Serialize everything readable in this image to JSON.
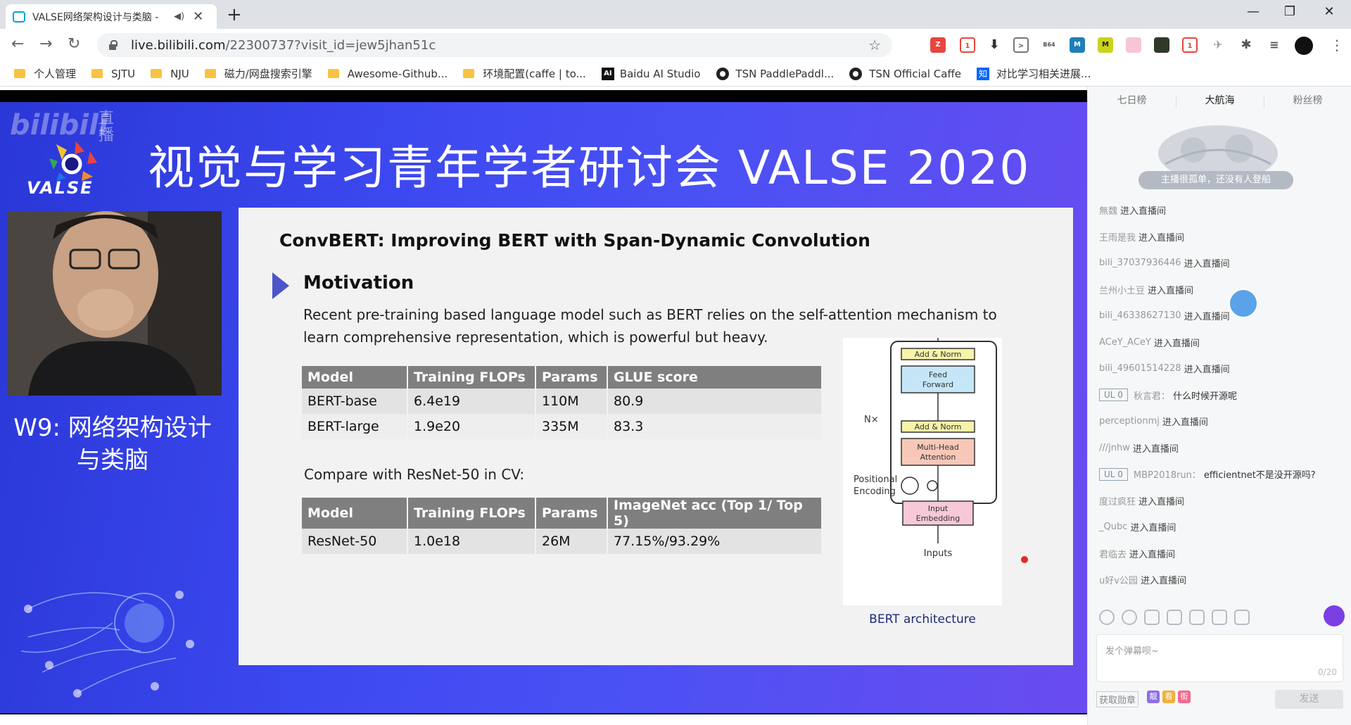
{
  "browser": {
    "tab_title": "VALSE网络架构设计与类脑 -",
    "tab_audio_icon": "speaker-icon",
    "url_host": "live.bilibili.com",
    "url_path": "/22300737?visit_id=jew5jhan51c",
    "bookmarks": [
      {
        "label": "个人管理",
        "icon": "folder"
      },
      {
        "label": "SJTU",
        "icon": "folder"
      },
      {
        "label": "NJU",
        "icon": "folder"
      },
      {
        "label": "磁力/网盘搜索引擎",
        "icon": "folder"
      },
      {
        "label": "Awesome-Github...",
        "icon": "folder"
      },
      {
        "label": "环境配置(caffe | to...",
        "icon": "folder"
      },
      {
        "label": "Baidu AI Studio",
        "icon": "ai"
      },
      {
        "label": "TSN PaddlePaddl...",
        "icon": "github"
      },
      {
        "label": "TSN Official Caffe",
        "icon": "github"
      },
      {
        "label": "对比学习相关进展...",
        "icon": "zhihu"
      }
    ],
    "ext_badges": [
      "1",
      "1"
    ]
  },
  "video": {
    "watermark": "bilibili",
    "watermark_live": "直播",
    "valse_logo_text": "VALSE",
    "banner": "视觉与学习青年学者研讨会 VALSE 2020",
    "session_title_line1": "W9: 网络架构设计",
    "session_title_line2": "与类脑",
    "slide": {
      "title": "ConvBERT: Improving BERT with Span-Dynamic Convolution",
      "section": "Motivation",
      "body": "Recent pre-training based language model such as BERT relies on the self-attention mechanism to learn comprehensive representation, which is powerful but heavy.",
      "table1": {
        "headers": [
          "Model",
          "Training FLOPs",
          "Params",
          "GLUE score"
        ],
        "rows": [
          [
            "BERT-base",
            "6.4e19",
            "110M",
            "80.9"
          ],
          [
            "BERT-large",
            "1.9e20",
            "335M",
            "83.3"
          ]
        ]
      },
      "compare_text": "Compare with ResNet-50 in CV:",
      "table2": {
        "headers": [
          "Model",
          "Training FLOPs",
          "Params",
          "ImageNet acc (Top 1/ Top 5)"
        ],
        "rows": [
          [
            "ResNet-50",
            "1.0e18",
            "26M",
            "77.15%/93.29%"
          ]
        ]
      },
      "arch": {
        "add_norm": "Add & Norm",
        "feed_forward_1": "Feed",
        "feed_forward_2": "Forward",
        "mha_1": "Multi-Head",
        "mha_2": "Attention",
        "nx": "N×",
        "pos_1": "Positional",
        "pos_2": "Encoding",
        "emb_1": "Input",
        "emb_2": "Embedding",
        "inputs": "Inputs",
        "caption": "BERT architecture"
      }
    }
  },
  "sidebar": {
    "rank_tabs": [
      "七日榜",
      "大航海",
      "粉丝榜"
    ],
    "empty_note": "主播很孤单，还没有人登船",
    "chat": [
      {
        "user": "無魏",
        "msg": "进入直播间",
        "type": "enter"
      },
      {
        "user": "王雨是我",
        "msg": "进入直播间",
        "type": "enter"
      },
      {
        "user": "bili_37037936446",
        "msg": "进入直播间",
        "type": "enter"
      },
      {
        "user": "兰州小土豆",
        "msg": "进入直播间",
        "type": "enter"
      },
      {
        "user": "bili_46338627130",
        "msg": "进入直播间",
        "type": "enter"
      },
      {
        "user": "ACeY_ACeY",
        "msg": "进入直播间",
        "type": "enter"
      },
      {
        "user": "bili_49601514228",
        "msg": "进入直播间",
        "type": "enter"
      },
      {
        "user": "秋言君：",
        "msg": "什么时候开源呢",
        "type": "danmu",
        "level": "UL 0"
      },
      {
        "user": "perceptionmj",
        "msg": "进入直播间",
        "type": "enter"
      },
      {
        "user": "///jnhw",
        "msg": "进入直播间",
        "type": "enter"
      },
      {
        "user": "MBP2018run：",
        "msg": "efficientnet不是没开源吗?",
        "type": "danmu",
        "level": "UL 0"
      },
      {
        "user": "度过疯狂",
        "msg": "进入直播间",
        "type": "enter"
      },
      {
        "user": "_Qubc",
        "msg": "进入直播间",
        "type": "enter"
      },
      {
        "user": "君临去",
        "msg": "进入直播间",
        "type": "enter"
      },
      {
        "user": "u好v公园",
        "msg": "进入直播间",
        "type": "enter"
      }
    ],
    "input_placeholder": "发个弹幕呗~",
    "input_count": "0/20",
    "medal_button": "获取勋章",
    "mini_badges": [
      {
        "label": "靓",
        "color": "#8e6de6"
      },
      {
        "label": "看",
        "color": "#f0b03c"
      },
      {
        "label": "街",
        "color": "#f16b8f"
      }
    ],
    "send_label": "发送"
  }
}
